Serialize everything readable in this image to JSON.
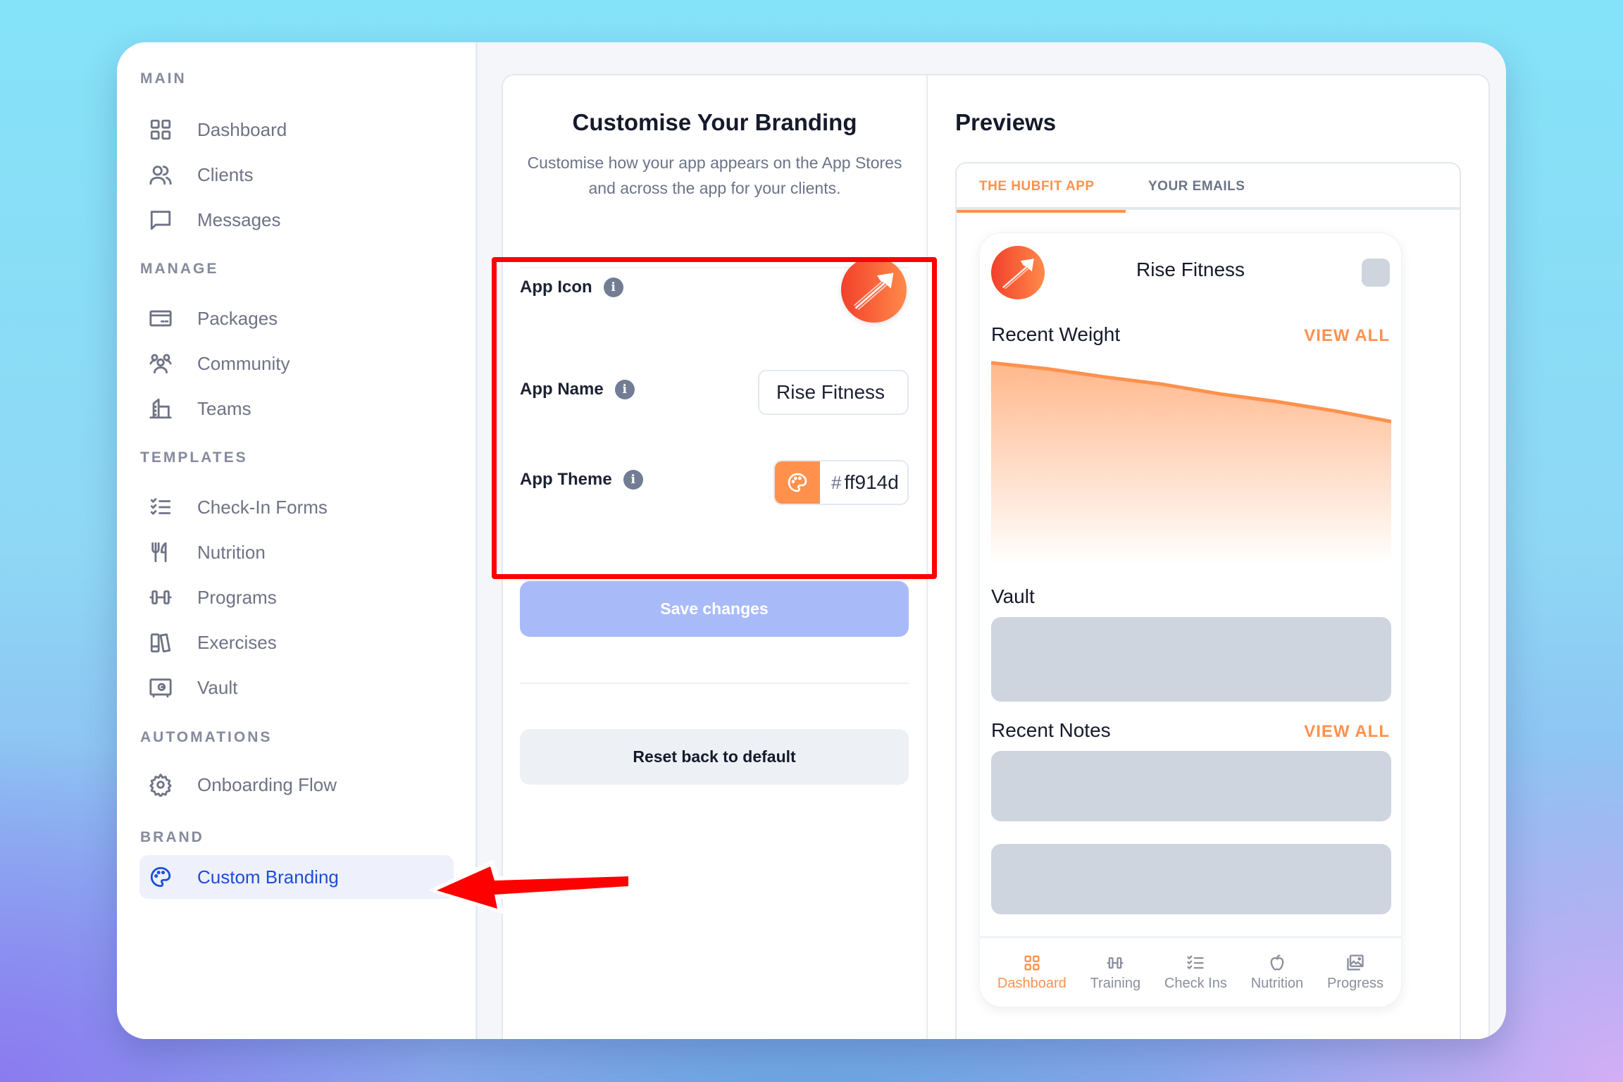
{
  "sidebar": {
    "sections": [
      {
        "title": "MAIN",
        "items": [
          {
            "label": "Dashboard",
            "icon": "grid-icon"
          },
          {
            "label": "Clients",
            "icon": "users-icon"
          },
          {
            "label": "Messages",
            "icon": "chat-icon"
          }
        ]
      },
      {
        "title": "MANAGE",
        "items": [
          {
            "label": "Packages",
            "icon": "card-icon"
          },
          {
            "label": "Community",
            "icon": "community-icon"
          },
          {
            "label": "Teams",
            "icon": "building-icon"
          }
        ]
      },
      {
        "title": "TEMPLATES",
        "items": [
          {
            "label": "Check-In Forms",
            "icon": "checklist-icon"
          },
          {
            "label": "Nutrition",
            "icon": "cutlery-icon"
          },
          {
            "label": "Programs",
            "icon": "dumbbell-icon"
          },
          {
            "label": "Exercises",
            "icon": "books-icon"
          },
          {
            "label": "Vault",
            "icon": "safe-icon"
          }
        ]
      },
      {
        "title": "AUTOMATIONS",
        "items": [
          {
            "label": "Onboarding Flow",
            "icon": "gear-icon"
          }
        ]
      },
      {
        "title": "BRAND",
        "items": [
          {
            "label": "Custom Branding",
            "icon": "palette-icon",
            "active": true
          }
        ]
      }
    ]
  },
  "branding": {
    "title": "Customise Your Branding",
    "subtitle": "Customise how your app appears on the App Stores and across the app for your clients.",
    "app_icon_label": "App Icon",
    "app_name_label": "App Name",
    "app_name_value": "Rise Fitness",
    "app_theme_label": "App Theme",
    "theme_hash": "#",
    "theme_value": "ff914d",
    "theme_color": "#ff914d",
    "info_glyph": "i",
    "save_label": "Save changes",
    "reset_label": "Reset back to default"
  },
  "previews": {
    "title": "Previews",
    "tabs": [
      {
        "label": "THE HUBFIT APP",
        "active": true
      },
      {
        "label": "YOUR EMAILS",
        "active": false
      }
    ],
    "phone": {
      "app_name": "Rise Fitness",
      "recent_weight": "Recent Weight",
      "view_all": "VIEW ALL",
      "vault": "Vault",
      "recent_notes": "Recent Notes",
      "bottom_nav": [
        {
          "label": "Dashboard",
          "active": true
        },
        {
          "label": "Training",
          "active": false
        },
        {
          "label": "Check Ins",
          "active": false
        },
        {
          "label": "Nutrition",
          "active": false
        },
        {
          "label": "Progress",
          "active": false
        }
      ]
    }
  },
  "chart_data": {
    "type": "area",
    "title": "Recent Weight",
    "x": [
      0,
      1,
      2,
      3,
      4,
      5,
      6,
      7
    ],
    "values": [
      100,
      98.8,
      97.2,
      95.8,
      93.9,
      92.4,
      90.6,
      88.5
    ],
    "ylim": [
      60,
      100
    ],
    "grid": false,
    "color": "#ff914d"
  },
  "colors": {
    "accent": "#ff914d",
    "primary": "#1d4ed8",
    "save_disabled": "#a8bbf8",
    "annotation": "#ff0000"
  }
}
